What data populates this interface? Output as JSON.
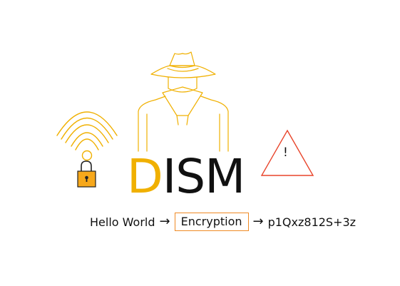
{
  "title": {
    "first_letter": "D",
    "rest": "ISM"
  },
  "flow": {
    "input": "Hello World",
    "arrow": "→",
    "process": "Encryption",
    "output": "p1Qxz812S+3z"
  },
  "warning": {
    "mark": "!"
  },
  "icons": {
    "spy": "spy-icon",
    "wifi": "wifi-signal-icon",
    "lock": "padlock-icon",
    "warning": "warning-triangle-icon"
  },
  "colors": {
    "accent": "#f0b000",
    "box_border": "#f08a24",
    "warning": "#e8442a",
    "text": "#111111"
  }
}
